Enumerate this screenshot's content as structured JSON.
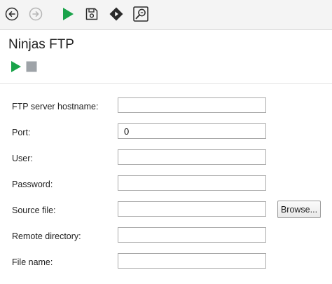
{
  "toolbar": {
    "buttons": [
      {
        "name": "back-icon"
      },
      {
        "name": "forward-icon"
      },
      {
        "name": "run-icon"
      },
      {
        "name": "save-icon"
      },
      {
        "name": "debug-icon"
      },
      {
        "name": "inspect-icon"
      }
    ]
  },
  "page": {
    "title": "Ninjas FTP"
  },
  "form": {
    "hostname_label": "FTP server hostname:",
    "hostname_value": "",
    "port_label": "Port:",
    "port_value": "0",
    "user_label": "User:",
    "user_value": "",
    "password_label": "Password:",
    "password_value": "",
    "source_file_label": "Source file:",
    "source_file_value": "",
    "browse_label": "Browse...",
    "remote_dir_label": "Remote directory:",
    "remote_dir_value": "",
    "file_name_label": "File name:",
    "file_name_value": ""
  },
  "colors": {
    "run_green": "#1aa34a",
    "stop_gray": "#9ea3a8",
    "icon_dark": "#2b2b2b",
    "icon_disabled": "#b5b5b5"
  }
}
